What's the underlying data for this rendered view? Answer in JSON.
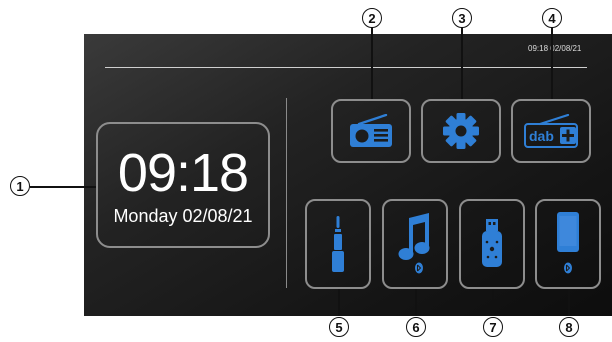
{
  "status_bar": {
    "time_date": "09:18  02/08/21"
  },
  "clock": {
    "time": "09:18",
    "date": "Monday 02/08/21"
  },
  "tiles_top": [
    {
      "id": "radio",
      "icon": "radio-icon",
      "label": "",
      "callout": "2"
    },
    {
      "id": "settings",
      "icon": "gear-icon",
      "label": "",
      "callout": "3"
    },
    {
      "id": "dab",
      "icon": "dab-plus-icon",
      "label": "dab",
      "callout": "4"
    }
  ],
  "tiles_bottom": [
    {
      "id": "aux",
      "icon": "aux-jack-icon",
      "callout": "5"
    },
    {
      "id": "bluetooth-music",
      "icon": "music-note-icon",
      "callout": "6"
    },
    {
      "id": "usb",
      "icon": "usb-stick-icon",
      "callout": "7"
    },
    {
      "id": "phone",
      "icon": "phone-icon",
      "callout": "8"
    }
  ],
  "clock_callout": "1",
  "colors": {
    "accent": "#2f7fd6",
    "tile_border": "#8d8d8d",
    "screen_bg": "#1c1c1c"
  }
}
